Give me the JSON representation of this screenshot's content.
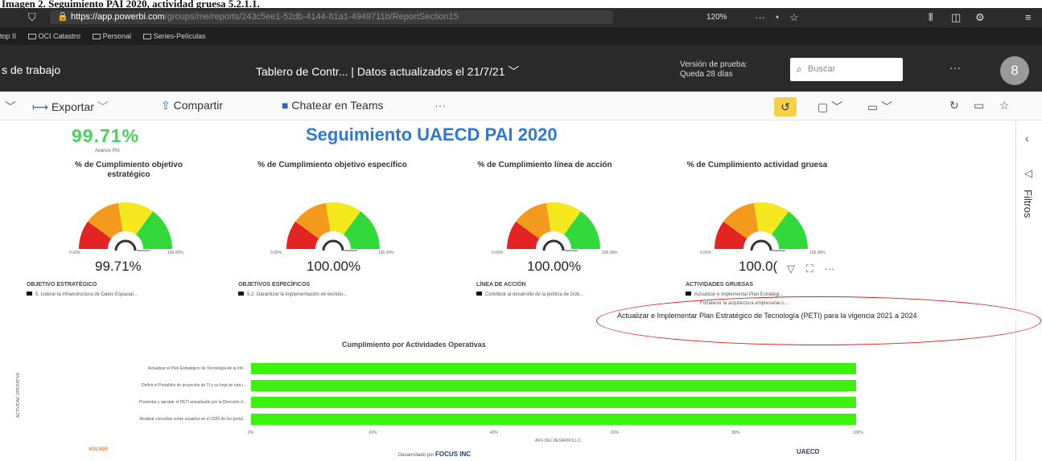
{
  "caption": "Imagen 2. Seguimiento PAI 2020, actividad gruesa 5.2.1.1.",
  "browser": {
    "url_host": "https://app.powerbi.com",
    "url_path": "/groups/me/reports/243c5ee1-52db-4144-81a1-4949711b/ReportSection15",
    "zoom": "120%",
    "more": "···"
  },
  "bookmarks": [
    "OCI Catastro",
    "Personal",
    "Series-Películas"
  ],
  "bookmarks_prefix": "top II",
  "pbi_header": {
    "workspace": "s de trabajo",
    "report_title": "Tablero de Contr...  |  Datos actualizados el 21/7/21",
    "trial_line1": "Versión de prueba:",
    "trial_line2": "Queda 28 días",
    "search_placeholder": "Buscar",
    "more": "···",
    "avatar_initial": "8"
  },
  "actionbar": {
    "export": "Exportar",
    "share": "Compartir",
    "teams": "Chatear en Teams",
    "more": "···"
  },
  "filters_label": "Filtros",
  "report": {
    "main_title": "Seguimiento UAECD PAI 2020",
    "avance_value": "99.71%",
    "avance_label": "Avance PAI",
    "gauges": [
      {
        "title": "% de Cumplimiento objetivo estratégico",
        "value": "99.71%",
        "min": "0.00%",
        "max": "100.00%",
        "card_label": "OBJETIVO ESTRATÉGICO",
        "legend": "5. Liderar la infraestructura de Datos Espacial..."
      },
      {
        "title": "% de Cumplimiento objetivo específico",
        "value": "100.00%",
        "min": "0.00%",
        "max": "100.00%",
        "card_label": "OBJETIVOS ESPECÍFICOS",
        "legend": "5.2. Garantizar la implementación de tecnolo..."
      },
      {
        "title": "% de Cumplimiento línea de acción",
        "value": "100.00%",
        "min": "0.00%",
        "max": "100.00%",
        "card_label": "LÍNEA DE ACCIÓN",
        "legend": "Contribuir al desarrollo de la política de Gob..."
      },
      {
        "title": "% de Cumplimiento actividad gruesa",
        "value": "100.0(",
        "min": "0.00%",
        "max": "100.00%",
        "card_label": "ACTIVIDADES GRUESAS",
        "legend": "Actualizar e Implementar Plan Estratégi..."
      }
    ],
    "gauge_value_fraction": 1.0,
    "extra_legend": "Fortalecer la arquitectura empresarial c...",
    "tooltip": "Actualizar e Implementar Plan Estratégico de Tecnología (PETI) para la vigencia 2021 a 2024",
    "volver": "VOLVER",
    "footer_prefix": "Desarrollado por",
    "footer_brand": "FOCUS INC",
    "uaecd_logo": "UAECD"
  },
  "chart_data": {
    "type": "bar",
    "title": "Cumplimiento por Actividades Operativas",
    "ylabel": "ACTIVIDAD OPERATIVA",
    "xlabel": "AVG DEL DESARROLLO",
    "categories": [
      "Actualizar el Plan Estratégico de Tecnología de la Infr...",
      "Definir el Portafolio de proyectos de TI y su hoja de ruta i...",
      "Presentar y aprobar el PETI actualizado por la Dirección d...",
      "Realizar consultas sobre usuarios en el 2020 de los portal..."
    ],
    "values": [
      100,
      100,
      100,
      100
    ],
    "xlim": [
      0,
      100
    ],
    "x_ticks": [
      "0%",
      "20%",
      "40%",
      "60%",
      "80%",
      "100%"
    ],
    "colors": {
      "bar": "#3df20f"
    }
  }
}
